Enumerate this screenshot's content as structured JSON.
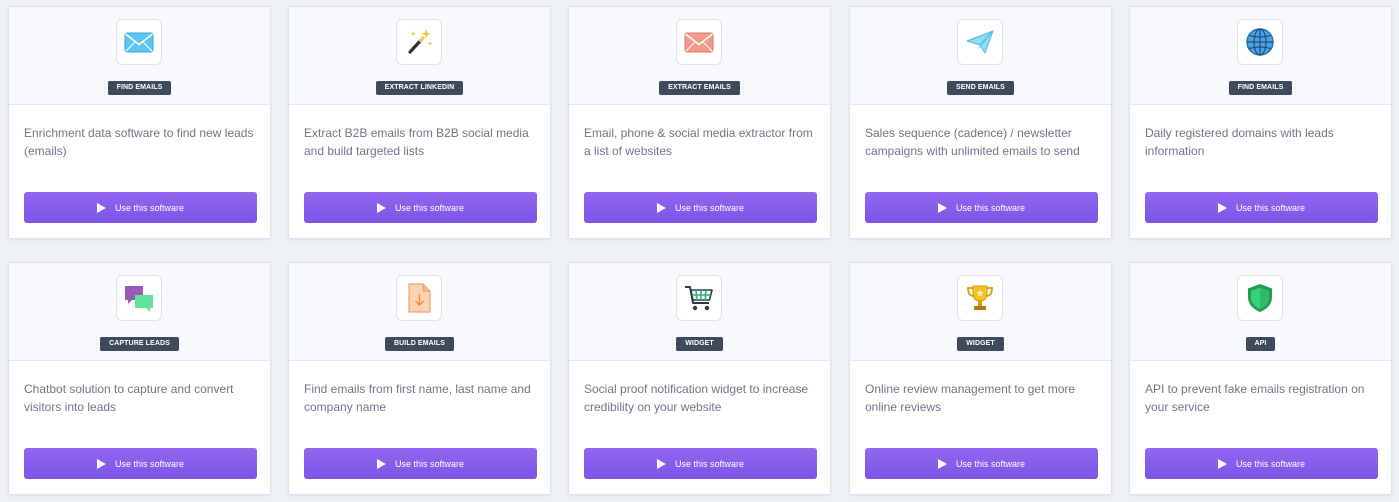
{
  "button_label": "Use this software",
  "cards": [
    {
      "tag": "FIND EMAILS",
      "icon": "envelope-icon",
      "description": "Enrichment data software to find new leads (emails)"
    },
    {
      "tag": "EXTRACT LINKEDIN",
      "icon": "magic-wand-icon",
      "description": "Extract B2B emails from B2B social media and build targeted lists"
    },
    {
      "tag": "EXTRACT EMAILS",
      "icon": "envelope-icon",
      "description": "Email, phone & social media extractor from a list of websites"
    },
    {
      "tag": "SEND EMAILS",
      "icon": "paper-plane-icon",
      "description": "Sales sequence (cadence) / newsletter campaigns with unlimited emails to send"
    },
    {
      "tag": "FIND EMAILS",
      "icon": "globe-icon",
      "description": "Daily registered domains with leads information"
    },
    {
      "tag": "CAPTURE LEADS",
      "icon": "chat-bubbles-icon",
      "description": "Chatbot solution to capture and convert visitors into leads"
    },
    {
      "tag": "BUILD EMAILS",
      "icon": "document-download-icon",
      "description": "Find emails from first name, last name and company name"
    },
    {
      "tag": "WIDGET",
      "icon": "shopping-cart-icon",
      "description": "Social proof notification widget to increase credibility on your website"
    },
    {
      "tag": "WIDGET",
      "icon": "trophy-icon",
      "description": "Online review management to get more online reviews"
    },
    {
      "tag": "API",
      "icon": "shield-icon",
      "description": "API to prevent fake emails registration on your service"
    }
  ]
}
